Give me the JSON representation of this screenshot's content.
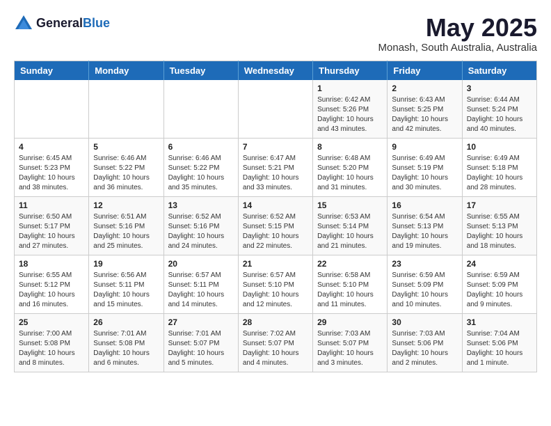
{
  "header": {
    "logo_general": "General",
    "logo_blue": "Blue",
    "month_title": "May 2025",
    "location": "Monash, South Australia, Australia"
  },
  "days_of_week": [
    "Sunday",
    "Monday",
    "Tuesday",
    "Wednesday",
    "Thursday",
    "Friday",
    "Saturday"
  ],
  "weeks": [
    [
      {
        "num": "",
        "info": ""
      },
      {
        "num": "",
        "info": ""
      },
      {
        "num": "",
        "info": ""
      },
      {
        "num": "",
        "info": ""
      },
      {
        "num": "1",
        "info": "Sunrise: 6:42 AM\nSunset: 5:26 PM\nDaylight: 10 hours\nand 43 minutes."
      },
      {
        "num": "2",
        "info": "Sunrise: 6:43 AM\nSunset: 5:25 PM\nDaylight: 10 hours\nand 42 minutes."
      },
      {
        "num": "3",
        "info": "Sunrise: 6:44 AM\nSunset: 5:24 PM\nDaylight: 10 hours\nand 40 minutes."
      }
    ],
    [
      {
        "num": "4",
        "info": "Sunrise: 6:45 AM\nSunset: 5:23 PM\nDaylight: 10 hours\nand 38 minutes."
      },
      {
        "num": "5",
        "info": "Sunrise: 6:46 AM\nSunset: 5:22 PM\nDaylight: 10 hours\nand 36 minutes."
      },
      {
        "num": "6",
        "info": "Sunrise: 6:46 AM\nSunset: 5:22 PM\nDaylight: 10 hours\nand 35 minutes."
      },
      {
        "num": "7",
        "info": "Sunrise: 6:47 AM\nSunset: 5:21 PM\nDaylight: 10 hours\nand 33 minutes."
      },
      {
        "num": "8",
        "info": "Sunrise: 6:48 AM\nSunset: 5:20 PM\nDaylight: 10 hours\nand 31 minutes."
      },
      {
        "num": "9",
        "info": "Sunrise: 6:49 AM\nSunset: 5:19 PM\nDaylight: 10 hours\nand 30 minutes."
      },
      {
        "num": "10",
        "info": "Sunrise: 6:49 AM\nSunset: 5:18 PM\nDaylight: 10 hours\nand 28 minutes."
      }
    ],
    [
      {
        "num": "11",
        "info": "Sunrise: 6:50 AM\nSunset: 5:17 PM\nDaylight: 10 hours\nand 27 minutes."
      },
      {
        "num": "12",
        "info": "Sunrise: 6:51 AM\nSunset: 5:16 PM\nDaylight: 10 hours\nand 25 minutes."
      },
      {
        "num": "13",
        "info": "Sunrise: 6:52 AM\nSunset: 5:16 PM\nDaylight: 10 hours\nand 24 minutes."
      },
      {
        "num": "14",
        "info": "Sunrise: 6:52 AM\nSunset: 5:15 PM\nDaylight: 10 hours\nand 22 minutes."
      },
      {
        "num": "15",
        "info": "Sunrise: 6:53 AM\nSunset: 5:14 PM\nDaylight: 10 hours\nand 21 minutes."
      },
      {
        "num": "16",
        "info": "Sunrise: 6:54 AM\nSunset: 5:13 PM\nDaylight: 10 hours\nand 19 minutes."
      },
      {
        "num": "17",
        "info": "Sunrise: 6:55 AM\nSunset: 5:13 PM\nDaylight: 10 hours\nand 18 minutes."
      }
    ],
    [
      {
        "num": "18",
        "info": "Sunrise: 6:55 AM\nSunset: 5:12 PM\nDaylight: 10 hours\nand 16 minutes."
      },
      {
        "num": "19",
        "info": "Sunrise: 6:56 AM\nSunset: 5:11 PM\nDaylight: 10 hours\nand 15 minutes."
      },
      {
        "num": "20",
        "info": "Sunrise: 6:57 AM\nSunset: 5:11 PM\nDaylight: 10 hours\nand 14 minutes."
      },
      {
        "num": "21",
        "info": "Sunrise: 6:57 AM\nSunset: 5:10 PM\nDaylight: 10 hours\nand 12 minutes."
      },
      {
        "num": "22",
        "info": "Sunrise: 6:58 AM\nSunset: 5:10 PM\nDaylight: 10 hours\nand 11 minutes."
      },
      {
        "num": "23",
        "info": "Sunrise: 6:59 AM\nSunset: 5:09 PM\nDaylight: 10 hours\nand 10 minutes."
      },
      {
        "num": "24",
        "info": "Sunrise: 6:59 AM\nSunset: 5:09 PM\nDaylight: 10 hours\nand 9 minutes."
      }
    ],
    [
      {
        "num": "25",
        "info": "Sunrise: 7:00 AM\nSunset: 5:08 PM\nDaylight: 10 hours\nand 8 minutes."
      },
      {
        "num": "26",
        "info": "Sunrise: 7:01 AM\nSunset: 5:08 PM\nDaylight: 10 hours\nand 6 minutes."
      },
      {
        "num": "27",
        "info": "Sunrise: 7:01 AM\nSunset: 5:07 PM\nDaylight: 10 hours\nand 5 minutes."
      },
      {
        "num": "28",
        "info": "Sunrise: 7:02 AM\nSunset: 5:07 PM\nDaylight: 10 hours\nand 4 minutes."
      },
      {
        "num": "29",
        "info": "Sunrise: 7:03 AM\nSunset: 5:07 PM\nDaylight: 10 hours\nand 3 minutes."
      },
      {
        "num": "30",
        "info": "Sunrise: 7:03 AM\nSunset: 5:06 PM\nDaylight: 10 hours\nand 2 minutes."
      },
      {
        "num": "31",
        "info": "Sunrise: 7:04 AM\nSunset: 5:06 PM\nDaylight: 10 hours\nand 1 minute."
      }
    ]
  ]
}
